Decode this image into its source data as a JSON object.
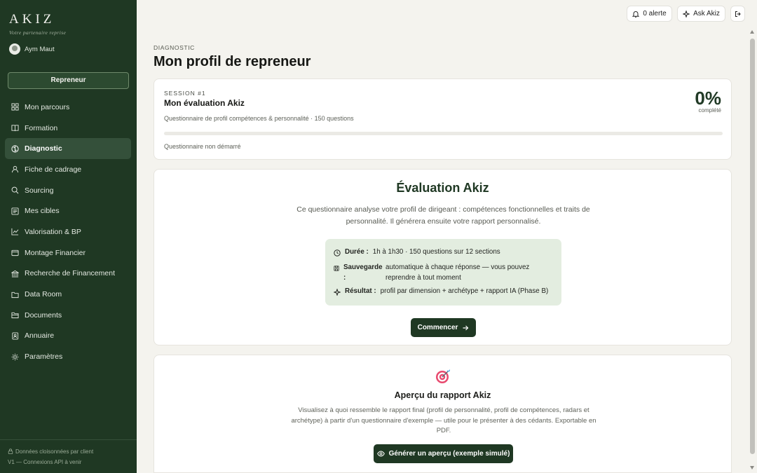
{
  "brand": {
    "name": "AKIZ",
    "tagline": "Votre partenaire reprise"
  },
  "user": {
    "name": "Aym Maut"
  },
  "role_button": "Repreneur",
  "nav": {
    "items": [
      {
        "label": "Mon parcours",
        "icon": "grid-icon"
      },
      {
        "label": "Formation",
        "icon": "book-icon"
      },
      {
        "label": "Diagnostic",
        "icon": "brain-icon",
        "active": true
      },
      {
        "label": "Fiche de cadrage",
        "icon": "user-icon"
      },
      {
        "label": "Sourcing",
        "icon": "search-icon"
      },
      {
        "label": "Mes cibles",
        "icon": "target-list-icon"
      },
      {
        "label": "Valorisation & BP",
        "icon": "chart-line-icon"
      },
      {
        "label": "Montage Financier",
        "icon": "wallet-icon"
      },
      {
        "label": "Recherche de Financement",
        "icon": "bank-icon"
      },
      {
        "label": "Data Room",
        "icon": "folder-icon"
      },
      {
        "label": "Documents",
        "icon": "folder-open-icon"
      },
      {
        "label": "Annuaire",
        "icon": "contacts-icon"
      },
      {
        "label": "Paramètres",
        "icon": "gear-icon"
      }
    ]
  },
  "sidebar_footer": {
    "line1": "Données cloisonnées par client",
    "line2": "V1 — Connexions API à venir"
  },
  "topbar": {
    "alerts_label": "0 alerte",
    "ask_label": "Ask Akiz"
  },
  "page": {
    "breadcrumb": "DIAGNOSTIC",
    "title": "Mon profil de repreneur"
  },
  "session": {
    "label": "SESSION #1",
    "title": "Mon évaluation Akiz",
    "subtitle": "Questionnaire de profil compétences & personnalité · 150 questions",
    "status": "Questionnaire non démarré",
    "percent_label": "0%",
    "percent_caption": "complété",
    "progress": 0
  },
  "evaluation": {
    "title": "Évaluation Akiz",
    "description": "Ce questionnaire analyse votre profil de dirigeant : compétences fonctionnelles et traits de personnalité. Il générera ensuite votre rapport personnalisé.",
    "duration_key": "Durée :",
    "duration_value": "1h à 1h30 · 150 questions sur 12 sections",
    "save_key_1": "Sauvegarde",
    "save_key_2": ":",
    "save_value_1": "automatique à chaque réponse — vous pouvez",
    "save_value_2": "reprendre à tout moment",
    "result_key": "Résultat :",
    "result_value": "profil par dimension + archétype + rapport IA (Phase B)",
    "start_button": "Commencer"
  },
  "report": {
    "title": "Aperçu du rapport Akiz",
    "description": "Visualisez à quoi ressemble le rapport final (profil de personnalité, profil de compétences, radars et archétype) à partir d'un questionnaire d'exemple — utile pour le présenter à des cédants. Exportable en PDF.",
    "button": "Générer un aperçu (exemple simulé)"
  },
  "colors": {
    "sidebar": "#1f3823",
    "accent": "#1f3823",
    "info_box": "#e3ede0",
    "background": "#f4f3ee"
  }
}
